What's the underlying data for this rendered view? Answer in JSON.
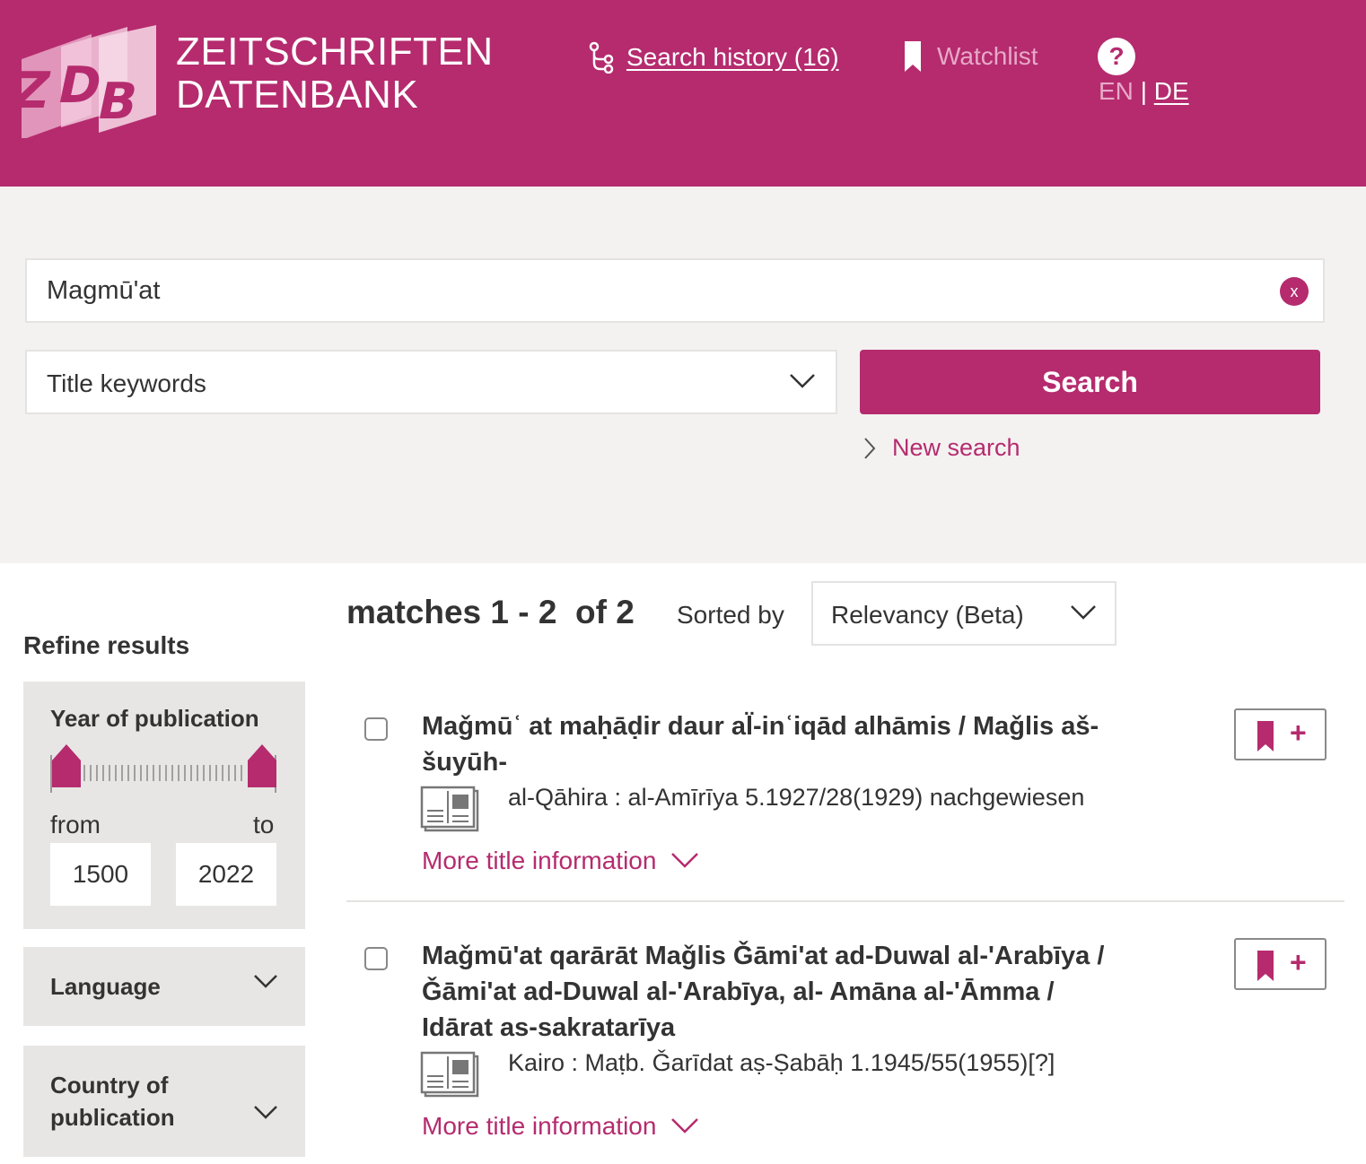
{
  "header": {
    "brand_line1": "ZEITSCHRIFTEN",
    "brand_line2": "DATENBANK",
    "logo_letters": "ZDB",
    "search_history": "Search history (16)",
    "watchlist": "Watchlist",
    "help": "?",
    "lang_en": "EN",
    "lang_sep": "|",
    "lang_de": "DE"
  },
  "search": {
    "query": "Magmū'at",
    "clear": "x",
    "field": "Title keywords",
    "button": "Search",
    "new_search": "New search"
  },
  "results_header": {
    "matches": "matches 1 - 2  of 2",
    "sorted_by": "Sorted by",
    "sort_value": "Relevancy (Beta)"
  },
  "sidebar": {
    "refine": "Refine results",
    "year": {
      "title": "Year of publication",
      "from_label": "from",
      "to_label": "to",
      "from": "1500",
      "to": "2022"
    },
    "language": "Language",
    "country_line1": "Country of",
    "country_line2": "publication"
  },
  "results": [
    {
      "title_line1": "Maǧmūʿ at maḥāḍir daur al̈-inʿiqād alhāmis / Maǧlis aš-",
      "title_line2": "šuyūh-",
      "meta": "al-Qāhira : al-Amīrīya 5.1927/28(1929) nachgewiesen",
      "more": "More title information"
    },
    {
      "title_line1": "Maǧmū'at qarārāt Maǧlis Ǧāmi'at ad-Duwal al-'Arabīya /",
      "title_line2": "Ǧāmi'at ad-Duwal al-'Arabīya, al- Amāna al-'Āmma /",
      "title_line3": "Idārat as-sakratarīya",
      "meta": "Kairo : Maṭb. Ǧarīdat aṣ-Ṣabāḥ 1.1945/55(1955)[?]",
      "more": "More title information"
    }
  ],
  "watchlist_add": "+",
  "colors": {
    "brand": "#b52b6e",
    "brand_light": "#e7a9c8",
    "panel_bg": "#f3f2f1",
    "facet_bg": "#e8e6e4"
  },
  "icons": [
    "history-icon",
    "bookmark-icon",
    "help-icon",
    "clear-icon",
    "chevron-down-icon",
    "chevron-right-icon",
    "newspaper-icon"
  ]
}
